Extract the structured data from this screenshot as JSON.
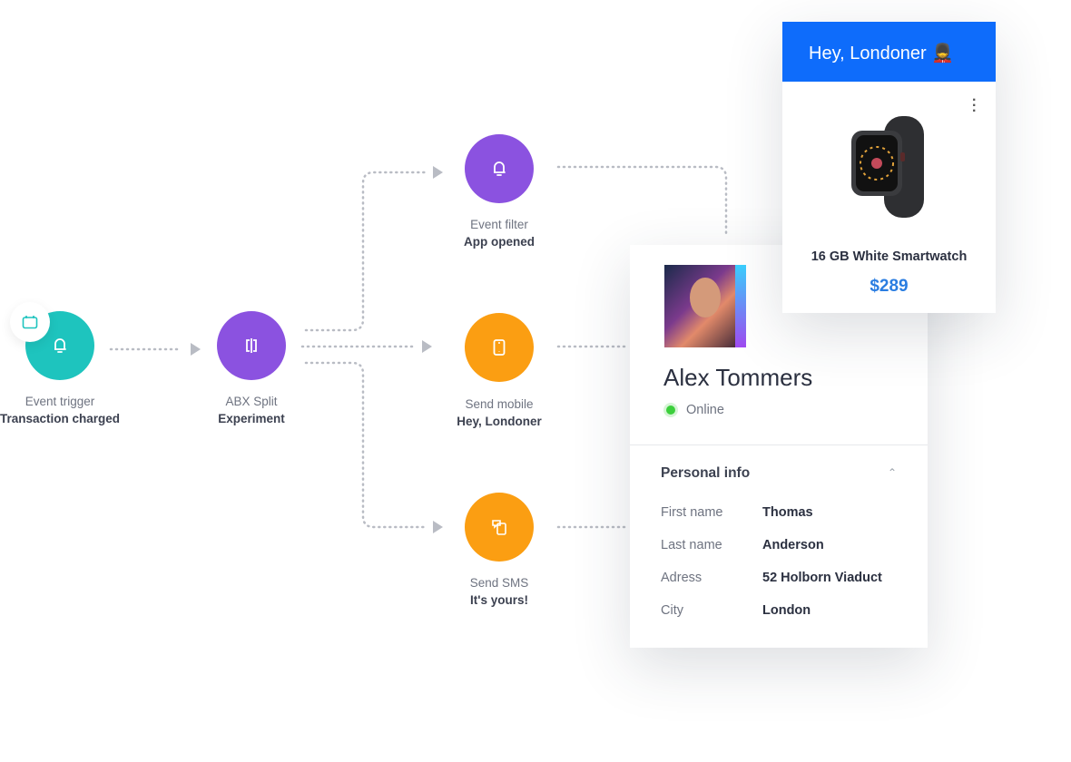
{
  "flow": {
    "nodes": [
      {
        "title": "Event trigger",
        "subtitle": "Transaction charged",
        "icon": "bell-icon",
        "color": "#1ec4be"
      },
      {
        "title": "ABX Split",
        "subtitle": "Experiment",
        "icon": "split-icon",
        "color": "#8b52e0"
      },
      {
        "title": "Event filter",
        "subtitle": "App opened",
        "icon": "bell-icon",
        "color": "#8b52e0"
      },
      {
        "title": "Send mobile",
        "subtitle": "Hey, Londoner",
        "icon": "mobile-icon",
        "color": "#fb9e12"
      },
      {
        "title": "Send SMS",
        "subtitle": "It's yours!",
        "icon": "sms-icon",
        "color": "#fb9e12"
      }
    ],
    "badge_icon": "calendar-icon"
  },
  "profile": {
    "name": "Alex Tommers",
    "status": "Online",
    "status_color": "#3ccf3c",
    "section_title": "Personal info",
    "fields": [
      {
        "label": "First name",
        "value": "Thomas"
      },
      {
        "label": "Last name",
        "value": "Anderson"
      },
      {
        "label": "Adress",
        "value": "52 Holborn Viaduct"
      },
      {
        "label": "City",
        "value": "London"
      }
    ]
  },
  "push": {
    "title": "Hey, Londoner 💂",
    "header_color": "#0e6cfb",
    "product_name": "16 GB White Smartwatch",
    "price": "$289"
  }
}
